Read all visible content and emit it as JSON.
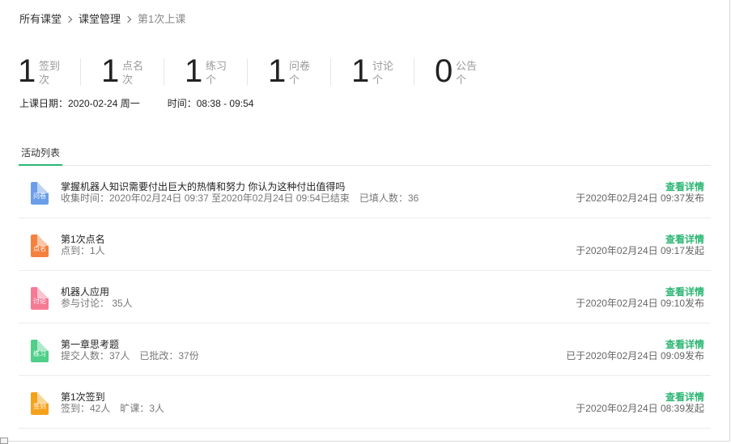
{
  "breadcrumb": {
    "items": [
      "所有课堂",
      "课堂管理",
      "第1次上课"
    ]
  },
  "stats": [
    {
      "value": "1",
      "label": "签到",
      "unit": "次"
    },
    {
      "value": "1",
      "label": "点名",
      "unit": "次"
    },
    {
      "value": "1",
      "label": "练习",
      "unit": "个"
    },
    {
      "value": "1",
      "label": "问卷",
      "unit": "个"
    },
    {
      "value": "1",
      "label": "讨论",
      "unit": "个"
    },
    {
      "value": "0",
      "label": "公告",
      "unit": "个"
    }
  ],
  "session": {
    "date": "上课日期：2020-02-24 周一",
    "time": "时间：08:38 - 09:54"
  },
  "tabs": {
    "activity": "活动列表"
  },
  "activities": [
    {
      "icon_label": "问卷",
      "icon": "questionnaire-file-icon",
      "color": "#6a9ee8",
      "title": "掌握机器人知识需要付出巨大的热情和努力 你认为这种付出值得吗",
      "meta1": "收集时间：2020年02月24日 09:37 至2020年02月24日 09:54已结束",
      "meta2": "已填人数：36",
      "link": "查看详情",
      "published": "于2020年02月24日 09:37发布"
    },
    {
      "icon_label": "点名",
      "icon": "rollcall-file-icon",
      "color": "#f5813f",
      "title": "第1次点名",
      "meta1": "点到：1人",
      "meta2": "",
      "link": "查看详情",
      "published": "于2020年02月24日 09:17发起"
    },
    {
      "icon_label": "讨论",
      "icon": "discussion-file-icon",
      "color": "#f57b95",
      "title": "机器人应用",
      "meta1": "参与讨论： 35人",
      "meta2": "",
      "link": "查看详情",
      "published": "于2020年02月24日 09:10发布"
    },
    {
      "icon_label": "练习",
      "icon": "exercise-file-icon",
      "color": "#4fcf8a",
      "title": "第一章思考题",
      "meta1": "提交人数：37人",
      "meta2": "已批改：37份",
      "link": "查看详情",
      "published": "已于2020年02月24日 09:09发布"
    },
    {
      "icon_label": "签到",
      "icon": "checkin-file-icon",
      "color": "#f5a21b",
      "title": "第1次签到",
      "meta1": "签到：42人",
      "meta2": "旷课：3人",
      "link": "查看详情",
      "published": "于2020年02月24日 08:39发起"
    }
  ],
  "colors": {
    "accent": "#2bb673"
  }
}
